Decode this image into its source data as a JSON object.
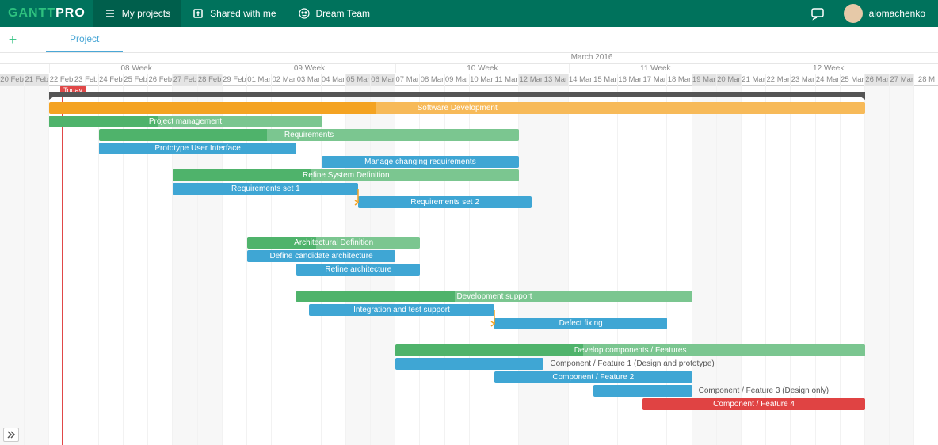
{
  "header": {
    "logo_a": "GANTT",
    "logo_b": "PRO",
    "my_projects": "My projects",
    "shared": "Shared with me",
    "team": "Dream Team",
    "user": "alomachenko"
  },
  "tabs": {
    "project": "Project"
  },
  "timeline": {
    "month": "March 2016",
    "weeks": [
      "08 Week",
      "09 Week",
      "10 Week",
      "11 Week",
      "12 Week"
    ],
    "days": [
      "20 Feb",
      "21 Feb",
      "22 Feb",
      "23 Feb",
      "24 Feb",
      "25 Feb",
      "26 Feb",
      "27 Feb",
      "28 Feb",
      "29 Feb",
      "01 Mar",
      "02 Mar",
      "03 Mar",
      "04 Mar",
      "05 Mar",
      "06 Mar",
      "07 Mar",
      "08 Mar",
      "09 Mar",
      "10 Mar",
      "11 Mar",
      "12 Mar",
      "13 Mar",
      "14 Mar",
      "15 Mar",
      "16 Mar",
      "17 Mar",
      "18 Mar",
      "19 Mar",
      "20 Mar",
      "21 Mar",
      "22 Mar",
      "23 Mar",
      "24 Mar",
      "25 Mar",
      "26 Mar",
      "27 Mar",
      "28 M"
    ],
    "weekend_idx": [
      0,
      1,
      7,
      8,
      14,
      15,
      21,
      22,
      28,
      29,
      35,
      36
    ],
    "today": "Today"
  },
  "chart_data": {
    "type": "gantt",
    "date_range": [
      "2016-02-20",
      "2016-03-28"
    ],
    "tasks": [
      {
        "name": "Software Development",
        "type": "summary",
        "color": "orange",
        "start": 2,
        "end": 35,
        "row": 1
      },
      {
        "name": "Project management",
        "type": "summary",
        "color": "green",
        "start": 2,
        "end": 13,
        "row": 2
      },
      {
        "name": "Requirements",
        "type": "summary",
        "color": "green",
        "start": 4,
        "end": 21,
        "row": 3
      },
      {
        "name": "Prototype User Interface",
        "type": "task",
        "color": "blue",
        "start": 4,
        "end": 12,
        "row": 4
      },
      {
        "name": "Manage changing requirements",
        "type": "task",
        "color": "blue",
        "start": 13,
        "end": 21,
        "row": 5
      },
      {
        "name": "Refine System Definition",
        "type": "summary",
        "color": "green",
        "start": 7,
        "end": 21,
        "row": 6
      },
      {
        "name": "Requirements set 1",
        "type": "task",
        "color": "blue",
        "start": 7,
        "end": 14.5,
        "row": 7,
        "link_to": 8
      },
      {
        "name": "Requirements set 2",
        "type": "task",
        "color": "blue",
        "start": 14.5,
        "end": 21.5,
        "row": 8
      },
      {
        "name": "Architectural Definition",
        "type": "summary",
        "color": "green",
        "start": 10,
        "end": 17,
        "row": 11
      },
      {
        "name": "Define candidate architecture",
        "type": "task",
        "color": "blue",
        "start": 10,
        "end": 16,
        "row": 12
      },
      {
        "name": "Refine architecture",
        "type": "task",
        "color": "blue",
        "start": 12,
        "end": 17,
        "row": 13
      },
      {
        "name": "Development support",
        "type": "summary",
        "color": "green",
        "start": 12,
        "end": 28,
        "row": 15
      },
      {
        "name": "Integration and test support",
        "type": "task",
        "color": "blue",
        "start": 12.5,
        "end": 20,
        "row": 16,
        "link_to": 17
      },
      {
        "name": "Defect fixing",
        "type": "task",
        "color": "blue",
        "start": 20,
        "end": 27,
        "row": 17
      },
      {
        "name": "Develop components / Features",
        "type": "summary",
        "color": "green",
        "start": 16,
        "end": 35,
        "row": 19
      },
      {
        "name": "Component / Feature 1 (Design and prototype)",
        "type": "task",
        "color": "blue",
        "start": 16,
        "end": 22,
        "row": 20,
        "label_outside": true
      },
      {
        "name": "Component / Feature 2",
        "type": "task",
        "color": "blue",
        "start": 20,
        "end": 28,
        "row": 21
      },
      {
        "name": "Component / Feature 3 (Design only)",
        "type": "task",
        "color": "blue",
        "start": 24,
        "end": 28,
        "row": 22,
        "label_outside": true
      },
      {
        "name": "Component / Feature 4",
        "type": "task",
        "color": "red",
        "start": 26,
        "end": 35,
        "row": 23
      }
    ]
  }
}
